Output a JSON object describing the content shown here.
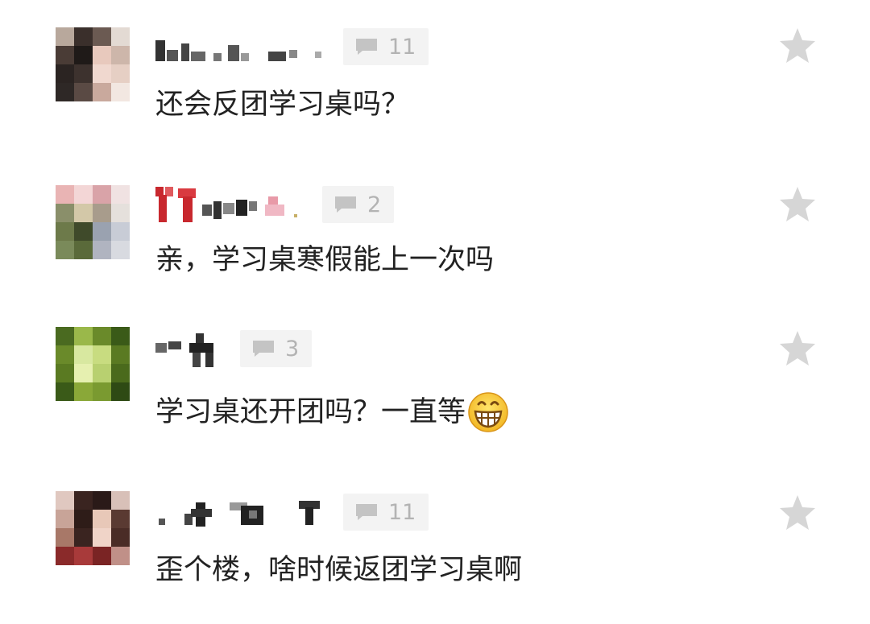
{
  "colors": {
    "text": "#222222",
    "badge_bg": "#f3f3f3",
    "badge_text": "#b3b3b3",
    "star": "#d6d6d6",
    "name_pixels": "#444444"
  },
  "comments": [
    {
      "username_censored": true,
      "reply_count": "11",
      "text": "还会反团学习桌吗？",
      "has_emoji": false
    },
    {
      "username_censored": true,
      "reply_count": "2",
      "text": "亲，学习桌寒假能上一次吗",
      "has_emoji": false
    },
    {
      "username_censored": true,
      "reply_count": "3",
      "text": "学习桌还开团吗？一直等",
      "has_emoji": true,
      "emoji": "grinning-face-emoji"
    },
    {
      "username_censored": true,
      "reply_count": "11",
      "text": "歪个楼，啥时候返团学习桌啊",
      "has_emoji": false
    }
  ],
  "icons": {
    "reply": "speech-bubble-icon",
    "favorite": "star-icon"
  }
}
